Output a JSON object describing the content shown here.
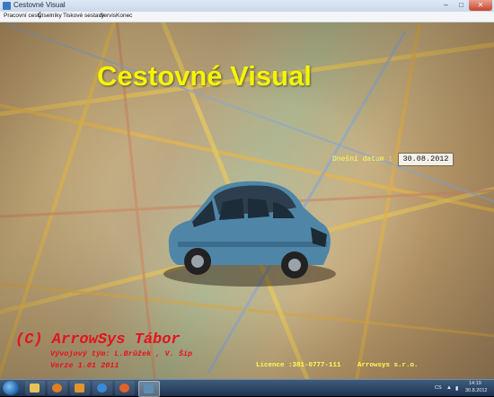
{
  "window": {
    "title": "Cestovné Visual",
    "minimize_glyph": "–",
    "maximize_glyph": "□",
    "close_glyph": "✕"
  },
  "menu": {
    "items": [
      "Pracovní cesty",
      "Číselníky",
      "Tiskové sestavy",
      "Servis",
      "Konec"
    ]
  },
  "main": {
    "app_title": "Cestovné Visual",
    "date_label": "Dnešní datum :",
    "date_value": "30.08.2012",
    "copyright": "(C) ArrowSys Tábor",
    "team": "Vývojový tým: L.Brůžek , V. Šíp",
    "version": "Verze 1.01 2011",
    "licence": "Licence :381-0777-111",
    "company": "Arrowsys s.r.o."
  },
  "taskbar": {
    "apps": [
      "start-orb",
      "explorer",
      "media-player",
      "outlook",
      "internet-explorer",
      "firefox",
      "cestovne-visual"
    ],
    "language": "CS",
    "time": "14:19",
    "date": "30.8.2012"
  },
  "colors": {
    "title_yellow": "#f5f500",
    "label_yellow": "#fffd55",
    "credit_red": "#e4121d",
    "car_blue": "#4f86a8"
  }
}
